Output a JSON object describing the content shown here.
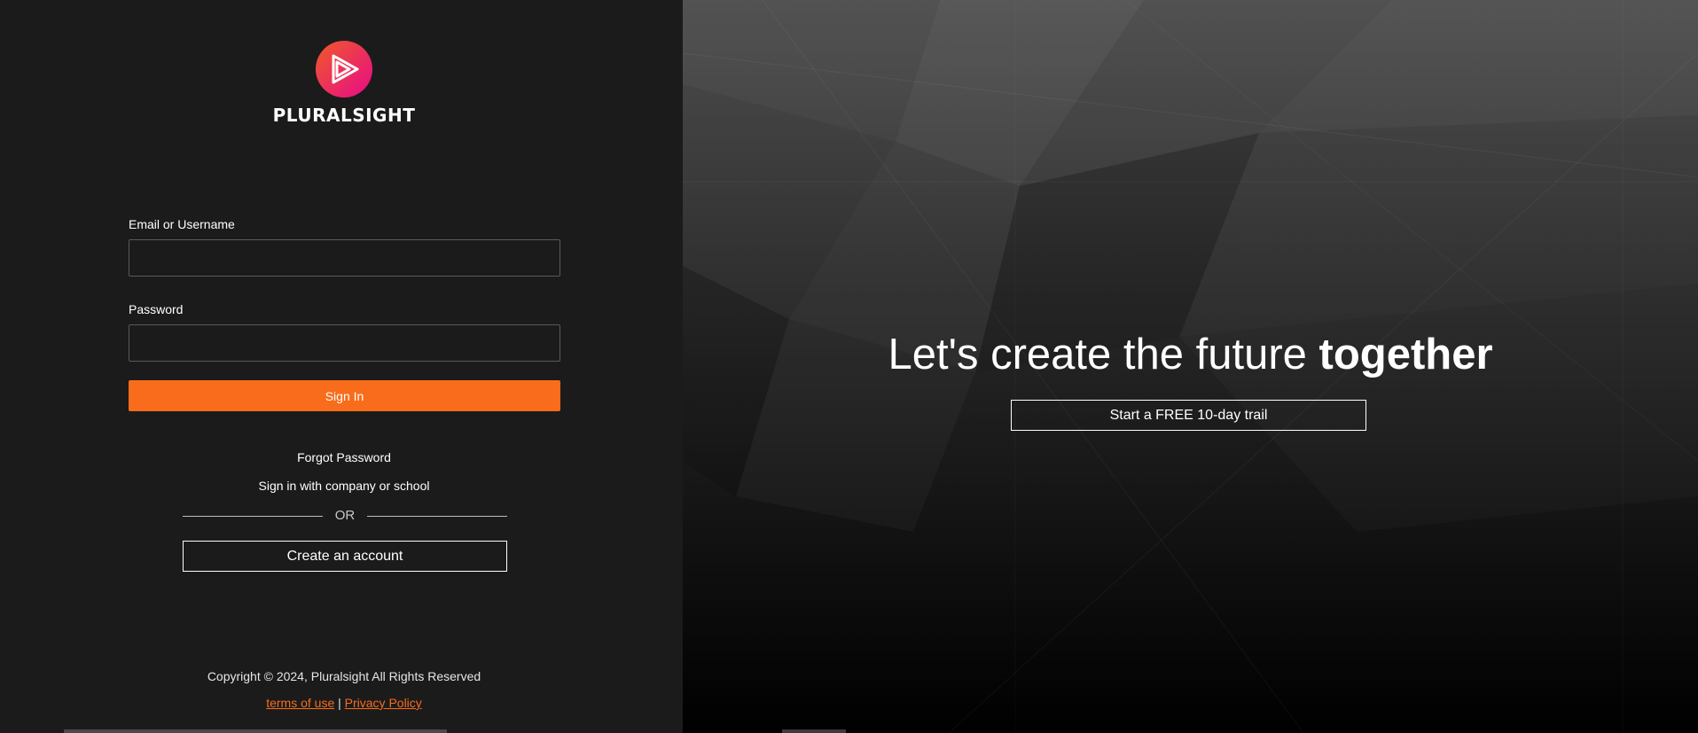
{
  "brand": {
    "name": "PLURALSIGHT",
    "logo_icon": "pluralsight-play-icon",
    "gradient_start": "#f05a28",
    "gradient_end": "#e80a89"
  },
  "login_form": {
    "email_label": "Email or Username",
    "email_value": "",
    "password_label": "Password",
    "password_value": "",
    "signin_label": "Sign In",
    "accent_color": "#f96c1b"
  },
  "links": {
    "forgot_password": "Forgot Password",
    "company_signin": "Sign in with company or school",
    "or_divider": "OR",
    "create_account": "Create an account"
  },
  "footer": {
    "copyright": "Copyright © 2024, Pluralsight All Rights Reserved",
    "terms": "terms of use",
    "separator": "|",
    "privacy": "Privacy Policy"
  },
  "hero": {
    "headline_regular": "Let's create the future ",
    "headline_bold": "together",
    "trial_button": "Start a FREE 10-day trail"
  }
}
